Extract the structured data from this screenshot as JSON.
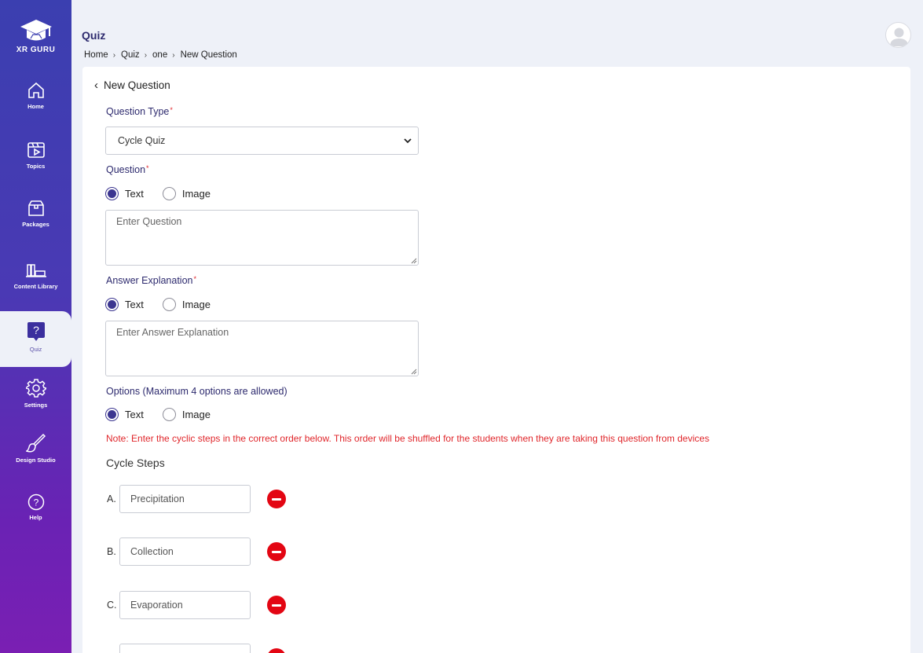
{
  "brand": {
    "name": "XR GURU"
  },
  "sidebar": {
    "items": [
      {
        "label": "Home",
        "icon": "home-icon"
      },
      {
        "label": "Topics",
        "icon": "video-icon"
      },
      {
        "label": "Packages",
        "icon": "package-icon"
      },
      {
        "label": "Content Library",
        "icon": "library-icon"
      },
      {
        "label": "Quiz",
        "icon": "quiz-icon",
        "active": true
      },
      {
        "label": "Settings",
        "icon": "gear-icon"
      },
      {
        "label": "Design Studio",
        "icon": "brush-icon"
      },
      {
        "label": "Help",
        "icon": "help-icon"
      }
    ]
  },
  "header": {
    "title": "Quiz",
    "breadcrumb": [
      "Home",
      "Quiz",
      "one",
      "New Question"
    ]
  },
  "form": {
    "back_label": "New Question",
    "question_type": {
      "label": "Question Type",
      "required_mark": "*",
      "value": "Cycle Quiz"
    },
    "question": {
      "label": "Question",
      "required_mark": "*",
      "option_text": "Text",
      "option_image": "Image",
      "selected": "Text",
      "placeholder": "Enter Question"
    },
    "answer_explanation": {
      "label": "Answer Explanation",
      "required_mark": "*",
      "option_text": "Text",
      "option_image": "Image",
      "selected": "Text",
      "placeholder": "Enter Answer Explanation"
    },
    "options": {
      "label": "Options (Maximum 4 options are allowed)",
      "option_text": "Text",
      "option_image": "Image",
      "selected": "Text"
    },
    "note": "Note: Enter the cyclic steps in the correct order below. This order will be shuffled for the students when they are taking this question from devices",
    "cycle_steps": {
      "title": "Cycle Steps",
      "steps": [
        {
          "letter": "A.",
          "value": "Precipitation"
        },
        {
          "letter": "B.",
          "value": "Collection"
        },
        {
          "letter": "C.",
          "value": "Evaporation"
        },
        {
          "letter": "",
          "value": ""
        }
      ]
    }
  },
  "colors": {
    "sidebar_top": "#3b3fb0",
    "sidebar_bottom": "#7a1fb3",
    "accent": "#3b3590",
    "danger": "#e30613",
    "note": "#e0262b"
  }
}
